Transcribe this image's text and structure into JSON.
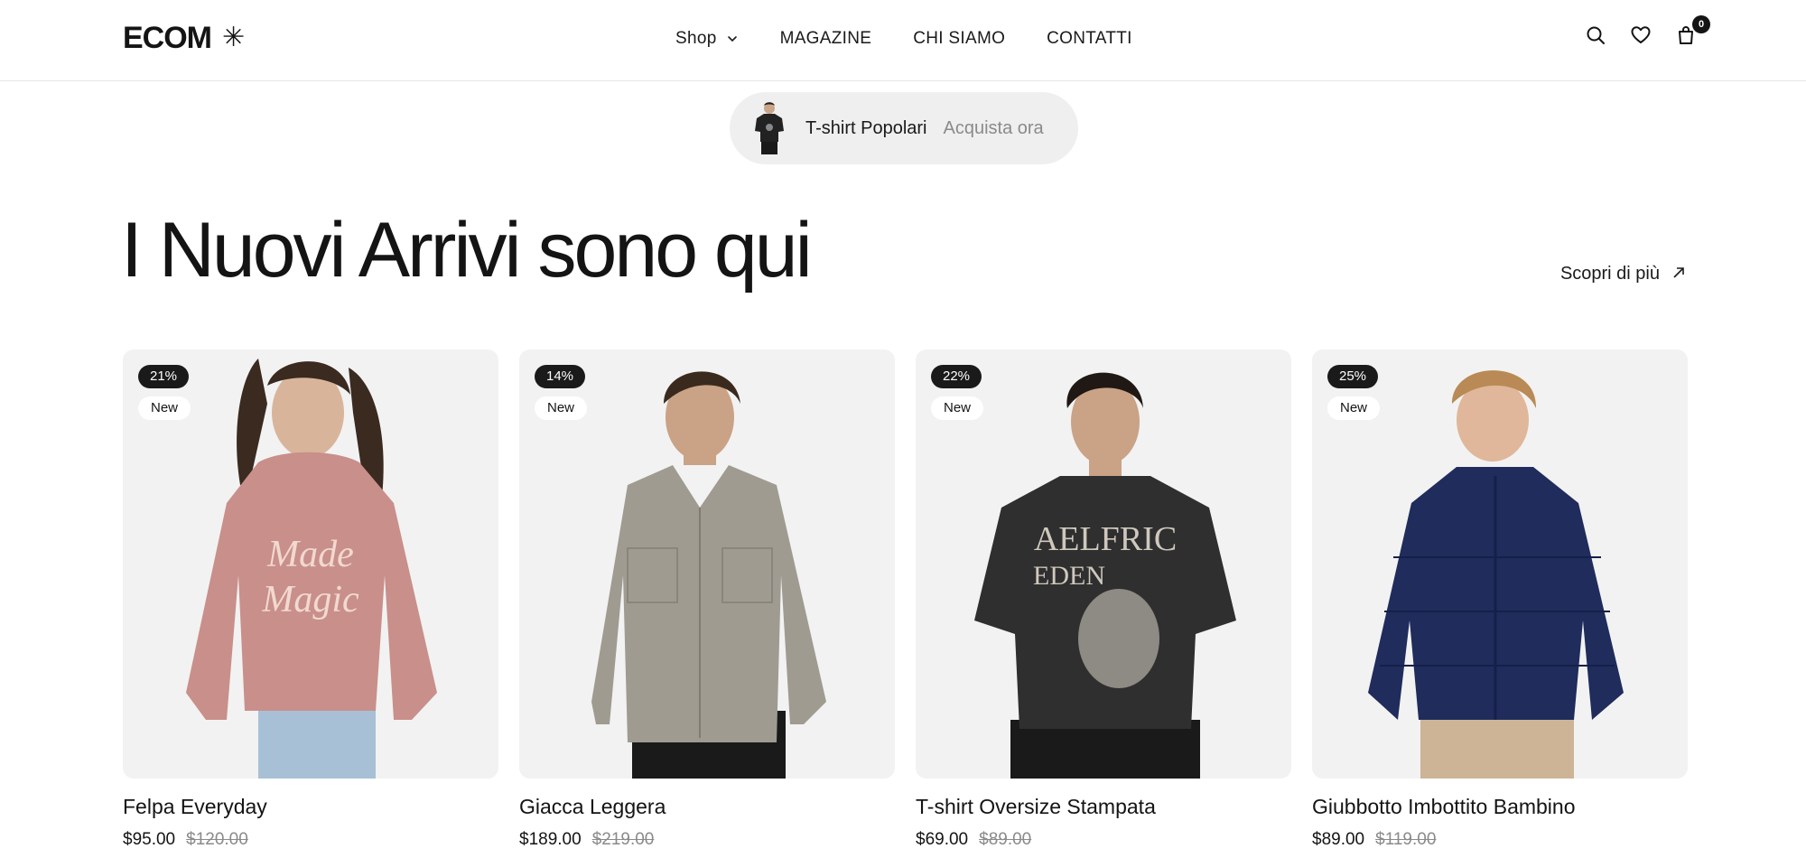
{
  "header": {
    "logo_text": "ECOM",
    "logo_mark": "✳",
    "nav": [
      {
        "label": "Shop",
        "has_dropdown": true
      },
      {
        "label": "MAGAZINE"
      },
      {
        "label": "CHI SIAMO"
      },
      {
        "label": "CONTATTI"
      }
    ],
    "icons": [
      "search-icon",
      "heart-icon",
      "shopping-bag-icon"
    ],
    "cart_count": "0"
  },
  "promo": {
    "title": "T-shirt Popolari",
    "cta": "Acquista ora"
  },
  "hero": {
    "title": "I Nuovi Arrivi sono qui",
    "discover_label": "Scopri di più"
  },
  "products": [
    {
      "name": "Felpa Everyday",
      "price": "$95.00",
      "old_price": "$120.00",
      "discount": "21%",
      "tag": "New",
      "color": "#c98f8a"
    },
    {
      "name": "Giacca Leggera",
      "price": "$189.00",
      "old_price": "$219.00",
      "discount": "14%",
      "tag": "New",
      "color": "#9f9b91"
    },
    {
      "name": "T-shirt Oversize Stampata",
      "price": "$69.00",
      "old_price": "$89.00",
      "discount": "22%",
      "tag": "New",
      "color": "#2f2f2f"
    },
    {
      "name": "Giubbotto Imbottito Bambino",
      "price": "$89.00",
      "old_price": "$119.00",
      "discount": "25%",
      "tag": "New",
      "color": "#1f2c5c"
    }
  ],
  "colors": {
    "accent": "#141414",
    "card_bg": "#f2f2f2",
    "muted": "#8a8a8a"
  }
}
